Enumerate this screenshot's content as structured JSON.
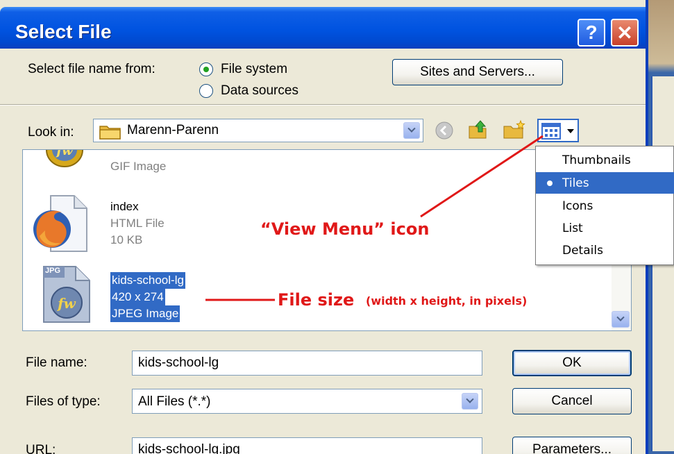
{
  "window": {
    "title": "Select File",
    "help_label": "?",
    "close_label": "✕"
  },
  "select_from": {
    "label": "Select file name from:",
    "options": [
      "File system",
      "Data sources"
    ],
    "selected": "File system"
  },
  "sites_button": "Sites and Servers...",
  "look_in": {
    "label": "Look in:",
    "value": "Marenn-Parenn"
  },
  "files": [
    {
      "name": "",
      "type": "GIF Image",
      "size": "",
      "icon": "dreamweaver-file-icon"
    },
    {
      "name": "index",
      "type": "HTML File",
      "size": "10 KB",
      "icon": "firefox-html-file-icon"
    },
    {
      "name": "kids-school-lg",
      "dimensions": "420 x 274",
      "type": "JPEG Image",
      "badge": "JPG",
      "icon": "jpg-file-icon",
      "selected": true
    }
  ],
  "view_menu": {
    "items": [
      "Thumbnails",
      "Tiles",
      "Icons",
      "List",
      "Details"
    ],
    "selected": "Tiles"
  },
  "annotations": {
    "view_menu": "“View Menu” icon",
    "file_size_main": "File size",
    "file_size_sub": "(width x height, in pixels)"
  },
  "file_name": {
    "label": "File name:",
    "value": "kids-school-lg"
  },
  "files_of_type": {
    "label": "Files of type:",
    "value": "All Files (*.*)"
  },
  "url": {
    "label": "URL:",
    "value": "kids-school-lg.jpg"
  },
  "buttons": {
    "ok": "OK",
    "cancel": "Cancel",
    "parameters": "Parameters..."
  },
  "colors": {
    "annotation": "#e01818",
    "selection": "#316ac5",
    "titlebar": "#0053e0"
  }
}
